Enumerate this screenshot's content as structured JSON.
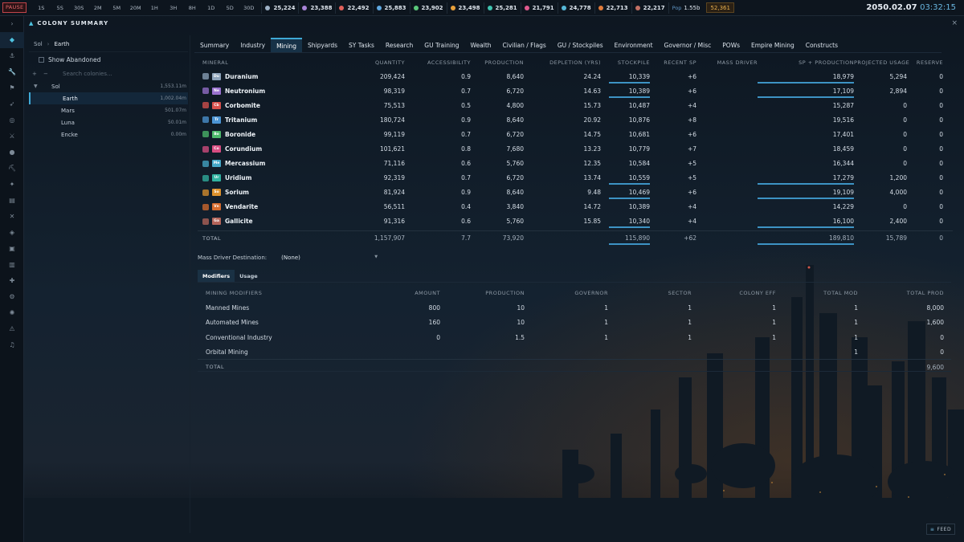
{
  "topbar": {
    "pause_label": "PAUSE",
    "speeds": [
      "1S",
      "5S",
      "30S",
      "2M",
      "5M",
      "20M",
      "1H",
      "3H",
      "8H",
      "1D",
      "5D",
      "30D"
    ],
    "resources": [
      {
        "icon": "duranium-icon",
        "value": "25,224",
        "color": "#9fb3c8"
      },
      {
        "icon": "neutronium-icon",
        "value": "23,388",
        "color": "#a884d8"
      },
      {
        "icon": "corbomite-icon",
        "value": "22,492",
        "color": "#e0605a"
      },
      {
        "icon": "tritanium-icon",
        "value": "25,883",
        "color": "#5fa8e0"
      },
      {
        "icon": "boronide-icon",
        "value": "23,902",
        "color": "#5ac87a"
      },
      {
        "icon": "sorium-icon",
        "value": "23,498",
        "color": "#e8a03a"
      },
      {
        "icon": "uridium-icon",
        "value": "25,281",
        "color": "#3fc4b0"
      },
      {
        "icon": "corundium-icon",
        "value": "21,791",
        "color": "#e05a8e"
      },
      {
        "icon": "mercassium-icon",
        "value": "24,778",
        "color": "#56b8d8"
      },
      {
        "icon": "vendarite-icon",
        "value": "22,713",
        "color": "#e07a3a"
      },
      {
        "icon": "gallicite-icon",
        "value": "22,217",
        "color": "#c27064"
      }
    ],
    "pop_label": "Pop",
    "pop_value": "1.55b",
    "wealth": "52,361",
    "date": "2050.02.07",
    "time": "03:32:15"
  },
  "rail_icons": [
    "colony-icon",
    "anchor-icon",
    "wrench-icon",
    "flag-icon",
    "rocket-icon",
    "target-icon",
    "swords-icon",
    "person-icon",
    "pickaxe-icon",
    "telescope-icon",
    "clipboard-icon",
    "cross-icon",
    "tag-icon",
    "box-icon",
    "document-icon",
    "hammer-icon",
    "gear-icon",
    "galaxy-icon",
    "warning-icon",
    "music-icon"
  ],
  "window": {
    "title": "COLONY SUMMARY"
  },
  "colony_list": {
    "crumb_system": "Sol",
    "crumb_colony": "Earth",
    "show_abandoned": "Show Abandoned",
    "search_placeholder": "Search colonies...",
    "system": {
      "name": "Sol",
      "pop": "1,553.11m"
    },
    "colonies": [
      {
        "name": "Earth",
        "pop": "1,002.04m",
        "selected": true
      },
      {
        "name": "Mars",
        "pop": "501.07m",
        "selected": false
      },
      {
        "name": "Luna",
        "pop": "50.01m",
        "selected": false
      },
      {
        "name": "Encke",
        "pop": "0.00m",
        "selected": false
      }
    ]
  },
  "tabs": [
    "Summary",
    "Industry",
    "Mining",
    "Shipyards",
    "SY Tasks",
    "Research",
    "GU Training",
    "Wealth",
    "Civilian / Flags",
    "GU / Stockpiles",
    "Environment",
    "Governor / Misc",
    "POWs",
    "Empire Mining",
    "Constructs"
  ],
  "active_tab": "Mining",
  "mineral_table": {
    "headers": [
      "MINERAL",
      "QUANTITY",
      "ACCESSIBILITY",
      "PRODUCTION",
      "DEPLETION (YRS)",
      "STOCKPILE",
      "RECENT SP",
      "MASS DRIVER",
      "SP + PRODUCTION",
      "PROJECTED USAGE",
      "RESERVE"
    ],
    "rows": [
      {
        "name": "Duranium",
        "sym": "Du",
        "color": "#8ea4bb",
        "quantity": "209,424",
        "accessibility": "0.9",
        "production": "8,640",
        "depletion": "24.24",
        "stockpile": "10,339",
        "recent_sp": "+6",
        "mass_driver": "",
        "sp_prod": "18,979",
        "projected": "5,294",
        "reserve": "0",
        "stk_ul": true,
        "sp_ul": true
      },
      {
        "name": "Neutronium",
        "sym": "Ne",
        "color": "#9a72cf",
        "quantity": "98,319",
        "accessibility": "0.7",
        "production": "6,720",
        "depletion": "14.63",
        "stockpile": "10,389",
        "recent_sp": "+6",
        "mass_driver": "",
        "sp_prod": "17,109",
        "projected": "2,894",
        "reserve": "0",
        "stk_ul": true,
        "sp_ul": true
      },
      {
        "name": "Corbomite",
        "sym": "Cb",
        "color": "#d8514d",
        "quantity": "75,513",
        "accessibility": "0.5",
        "production": "4,800",
        "depletion": "15.73",
        "stockpile": "10,487",
        "recent_sp": "+4",
        "mass_driver": "",
        "sp_prod": "15,287",
        "projected": "0",
        "reserve": "0",
        "stk_ul": false,
        "sp_ul": false
      },
      {
        "name": "Tritanium",
        "sym": "Tr",
        "color": "#4c95d4",
        "quantity": "180,724",
        "accessibility": "0.9",
        "production": "8,640",
        "depletion": "20.92",
        "stockpile": "10,876",
        "recent_sp": "+8",
        "mass_driver": "",
        "sp_prod": "19,516",
        "projected": "0",
        "reserve": "0",
        "stk_ul": false,
        "sp_ul": false
      },
      {
        "name": "Boronide",
        "sym": "Bo",
        "color": "#4cba6c",
        "quantity": "99,119",
        "accessibility": "0.7",
        "production": "6,720",
        "depletion": "14.75",
        "stockpile": "10,681",
        "recent_sp": "+6",
        "mass_driver": "",
        "sp_prod": "17,401",
        "projected": "0",
        "reserve": "0",
        "stk_ul": false,
        "sp_ul": false
      },
      {
        "name": "Corundium",
        "sym": "Co",
        "color": "#d84d82",
        "quantity": "101,621",
        "accessibility": "0.8",
        "production": "7,680",
        "depletion": "13.23",
        "stockpile": "10,779",
        "recent_sp": "+7",
        "mass_driver": "",
        "sp_prod": "18,459",
        "projected": "0",
        "reserve": "0",
        "stk_ul": false,
        "sp_ul": false
      },
      {
        "name": "Mercassium",
        "sym": "Me",
        "color": "#46a9c9",
        "quantity": "71,116",
        "accessibility": "0.6",
        "production": "5,760",
        "depletion": "12.35",
        "stockpile": "10,584",
        "recent_sp": "+5",
        "mass_driver": "",
        "sp_prod": "16,344",
        "projected": "0",
        "reserve": "0",
        "stk_ul": false,
        "sp_ul": false
      },
      {
        "name": "Uridium",
        "sym": "Ur",
        "color": "#31b3a1",
        "quantity": "92,319",
        "accessibility": "0.7",
        "production": "6,720",
        "depletion": "13.74",
        "stockpile": "10,559",
        "recent_sp": "+5",
        "mass_driver": "",
        "sp_prod": "17,279",
        "projected": "1,200",
        "reserve": "0",
        "stk_ul": true,
        "sp_ul": true
      },
      {
        "name": "Sorium",
        "sym": "So",
        "color": "#dd922e",
        "quantity": "81,924",
        "accessibility": "0.9",
        "production": "8,640",
        "depletion": "9.48",
        "stockpile": "10,469",
        "recent_sp": "+6",
        "mass_driver": "",
        "sp_prod": "19,109",
        "projected": "4,000",
        "reserve": "0",
        "stk_ul": true,
        "sp_ul": true
      },
      {
        "name": "Vendarite",
        "sym": "Vn",
        "color": "#d86c2e",
        "quantity": "56,511",
        "accessibility": "0.4",
        "production": "3,840",
        "depletion": "14.72",
        "stockpile": "10,389",
        "recent_sp": "+4",
        "mass_driver": "",
        "sp_prod": "14,229",
        "projected": "0",
        "reserve": "0",
        "stk_ul": false,
        "sp_ul": false
      },
      {
        "name": "Gallicite",
        "sym": "Ga",
        "color": "#b5655a",
        "quantity": "91,316",
        "accessibility": "0.6",
        "production": "5,760",
        "depletion": "15.85",
        "stockpile": "10,340",
        "recent_sp": "+4",
        "mass_driver": "",
        "sp_prod": "16,100",
        "projected": "2,400",
        "reserve": "0",
        "stk_ul": true,
        "sp_ul": true
      }
    ],
    "total": {
      "label": "TOTAL",
      "quantity": "1,157,907",
      "accessibility": "7.7",
      "production": "73,920",
      "depletion": "",
      "stockpile": "115,890",
      "recent_sp": "+62",
      "mass_driver": "",
      "sp_prod": "189,810",
      "projected": "15,789",
      "reserve": "0"
    }
  },
  "mass_driver": {
    "label": "Mass Driver Destination:",
    "value": "(None)"
  },
  "subtabs": [
    "Modifiers",
    "Usage"
  ],
  "active_subtab": "Modifiers",
  "modifiers_table": {
    "headers": [
      "MINING MODIFIERS",
      "AMOUNT",
      "PRODUCTION",
      "GOVERNOR",
      "SECTOR",
      "COLONY EFF",
      "TOTAL MOD",
      "TOTAL PROD"
    ],
    "rows": [
      {
        "name": "Manned Mines",
        "amount": "800",
        "production": "10",
        "governor": "1",
        "sector": "1",
        "colony_eff": "1",
        "total_mod": "1",
        "total_prod": "8,000"
      },
      {
        "name": "Automated Mines",
        "amount": "160",
        "production": "10",
        "governor": "1",
        "sector": "1",
        "colony_eff": "1",
        "total_mod": "1",
        "total_prod": "1,600"
      },
      {
        "name": "Conventional Industry",
        "amount": "0",
        "production": "1.5",
        "governor": "1",
        "sector": "1",
        "colony_eff": "1",
        "total_mod": "1",
        "total_prod": "0"
      },
      {
        "name": "Orbital Mining",
        "amount": "",
        "production": "",
        "governor": "",
        "sector": "",
        "colony_eff": "",
        "total_mod": "1",
        "total_prod": "0"
      }
    ],
    "total": {
      "label": "TOTAL",
      "total_prod": "9,600"
    }
  },
  "feed_label": "FEED"
}
